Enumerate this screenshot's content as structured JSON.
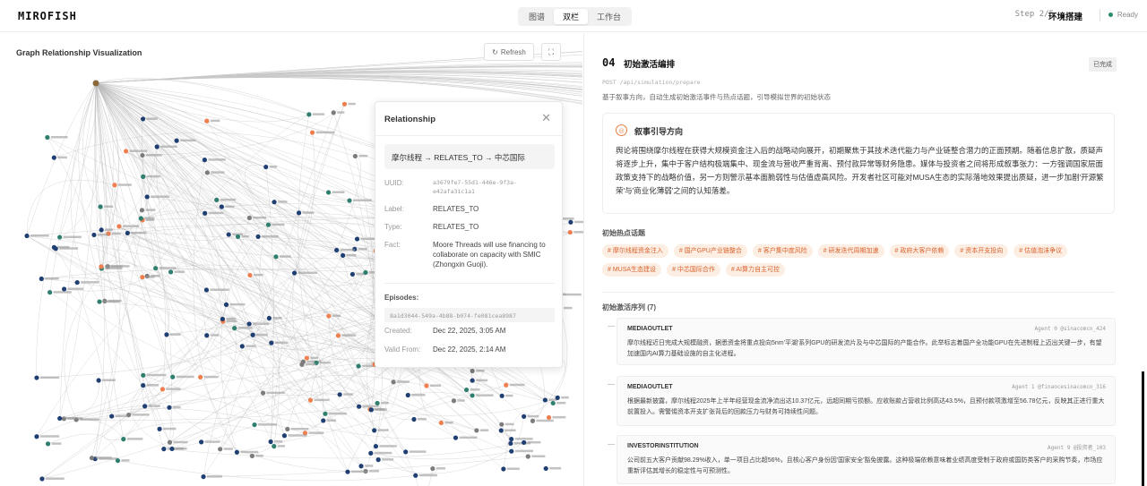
{
  "topbar": {
    "logo": "MIROFISH",
    "view_tabs": [
      "图谱",
      "双栏",
      "工作台"
    ],
    "active_tab": 1,
    "step": "Step 2/5",
    "step_name": "环境搭建",
    "status": "Ready",
    "status_color": "#2b8c6b"
  },
  "graph": {
    "title": "Graph Relationship Visualization",
    "refresh_label": "Refresh",
    "colors": {
      "blue": "#1f3f73",
      "orange": "#ef7f4f",
      "green": "#2f7f6f",
      "gray": "#7c7c7c"
    }
  },
  "relationship": {
    "header": "Relationship",
    "path": "摩尔线程 → RELATES_TO → 中芯国际",
    "uuid_label": "UUID:",
    "uuid": "a3679fe7-55d1-446e-9f3a-e42afa31c1a1",
    "label_label": "Label:",
    "label": "RELATES_TO",
    "type_label": "Type:",
    "type": "RELATES_TO",
    "fact_label": "Fact:",
    "fact": "Moore Threads will use financing to collaborate on capacity with SMIC (Zhongxin Guoji).",
    "episodes_label": "Episodes:",
    "episode": "8a1d3044-549a-4b88-b074-fe081cea8987",
    "created_label": "Created:",
    "created": "Dec 22, 2025, 3:05 AM",
    "valid_label": "Valid From:",
    "valid": "Dec 22, 2025, 2:14 AM"
  },
  "section": {
    "number": "04",
    "title": "初始激活编排",
    "badge": "已完成",
    "endpoint": "POST /api/simulation/prepare",
    "description": "基于叙事方向，自动生成初始激活事件与热点话题，引导模拟世界的初始状态",
    "narrative_header": "叙事引导方向",
    "narrative_text": "舆论将围绕摩尔线程在获得大规模资金注入后的战略动向展开，初期聚焦于其技术迭代能力与产业链整合潜力的正面预期。随着信息扩散，质疑声将逐步上升，集中于客户结构极端集中、现金流与营收严重背离、预付款异常等财务隐患。媒体与投资者之间将形成叙事张力：一方强调国家层面政策支持下的战略价值，另一方则警示基本面脆弱性与估值虚高风险。开发者社区可能对MUSA生态的实际落地效果提出质疑，进一步加剧'开源繁荣'与'商业化薄弱'之间的认知落差。",
    "hot_label": "初始热点话题",
    "tags": [
      "# 摩尔线程资金注入",
      "# 国产GPU产业链整合",
      "# 客户集中度风险",
      "# 研发迭代周期加速",
      "# 政府大客户依赖",
      "# 资本开支投向",
      "# 估值泡沫争议",
      "# MUSA生态建设",
      "# 中芯国际合作",
      "# AI算力自主可控"
    ],
    "seq_label": "初始激活序列 (7)",
    "posts": [
      {
        "type": "MEDIAOUTLET",
        "agent": "Agent 0 @sinacomcn_424",
        "text": "摩尔线程近日完成大规模融资，据悉资金将重点投向5nm'平湖'系列GPU的研发流片及与中芯国际的产能合作。此举标志着国产全功能GPU在先进制程上迈出关键一步，有望加速国内AI算力基础设施的自主化进程。"
      },
      {
        "type": "MEDIAOUTLET",
        "agent": "Agent 1 @financesinacomcn_316",
        "text": "根据最新披露，摩尔线程2025年上半年经营现金流净流出达10.37亿元，远超同期亏损额。应收账款占营收比例高达43.5%，且预付款项激增至56.78亿元，反映其正进行重大前置投入。需警惕资本开支扩张背后的回款压力与财务可持续性问题。"
      },
      {
        "type": "INVESTORINSTITUTION",
        "agent": "Agent 9 @投资者_103",
        "text": "公司前五大客户贡献98.29%收入，单一项目占比超56%，且核心客户身份因'国家安全'豁免披露。这种极端依赖意味着业绩高度受制于政府或国防类客户的采购节奏，市场应重新评估其增长的稳定性与可预测性。"
      }
    ]
  }
}
